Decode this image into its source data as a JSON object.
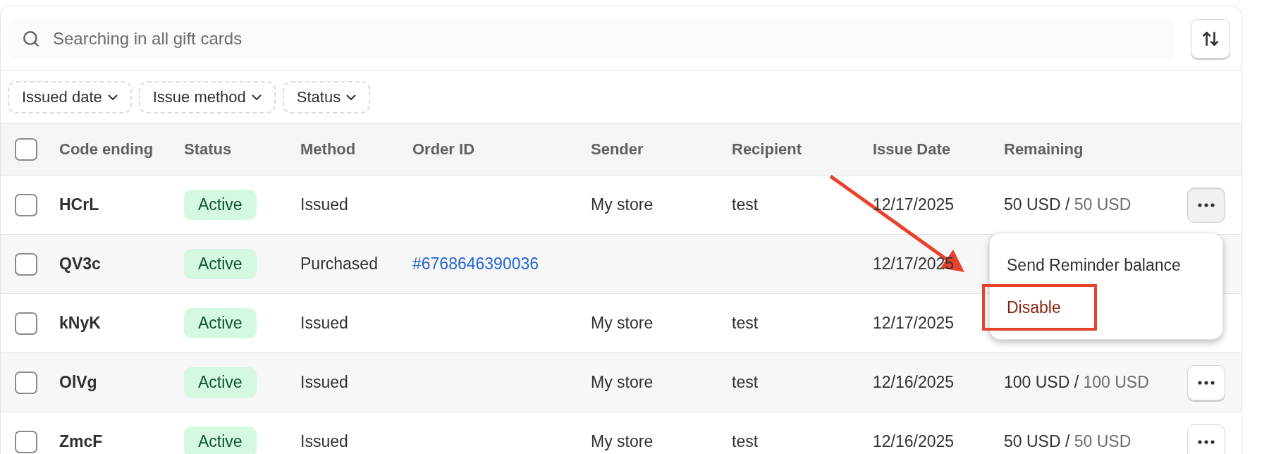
{
  "search": {
    "placeholder": "Searching in all gift cards"
  },
  "filters": [
    {
      "label": "Issued date"
    },
    {
      "label": "Issue method"
    },
    {
      "label": "Status"
    }
  ],
  "table": {
    "all_selected": false,
    "columns": [
      "Code ending",
      "Status",
      "Method",
      "Order ID",
      "Sender",
      "Recipient",
      "Issue Date",
      "Remaining"
    ],
    "rows": [
      {
        "selected": false,
        "code": "HCrL",
        "status": "Active",
        "method": "Issued",
        "sender": "My store",
        "recipient": "test",
        "issue_date": "12/17/2025",
        "remaining": {
          "amount": "50 USD",
          "separator": "/",
          "total": "50 USD"
        },
        "actions": {
          "pressed": true
        }
      },
      {
        "selected": false,
        "code": "QV3c",
        "status": "Active",
        "method": "Purchased",
        "order_id": "#6768646390036",
        "issue_date": "12/17/2025"
      },
      {
        "selected": false,
        "code": "kNyK",
        "status": "Active",
        "method": "Issued",
        "sender": "My store",
        "recipient": "test",
        "issue_date": "12/17/2025"
      },
      {
        "selected": false,
        "code": "OlVg",
        "status": "Active",
        "method": "Issued",
        "sender": "My store",
        "recipient": "test",
        "issue_date": "12/16/2025",
        "remaining": {
          "amount": "100 USD",
          "separator": "/",
          "total": "100 USD"
        },
        "actions": {
          "pressed": false
        }
      },
      {
        "selected": false,
        "code": "ZmcF",
        "status": "Active",
        "method": "Issued",
        "sender": "My store",
        "recipient": "test",
        "issue_date": "12/16/2025",
        "remaining": {
          "amount": "50 USD",
          "separator": "/",
          "total": "50 USD"
        },
        "actions": {
          "pressed": false
        }
      }
    ]
  },
  "menu": {
    "items": [
      {
        "label": "Send Reminder balance",
        "kind": "normal",
        "highlighted": false
      },
      {
        "label": "Disable",
        "kind": "danger",
        "highlighted": true
      }
    ]
  }
}
